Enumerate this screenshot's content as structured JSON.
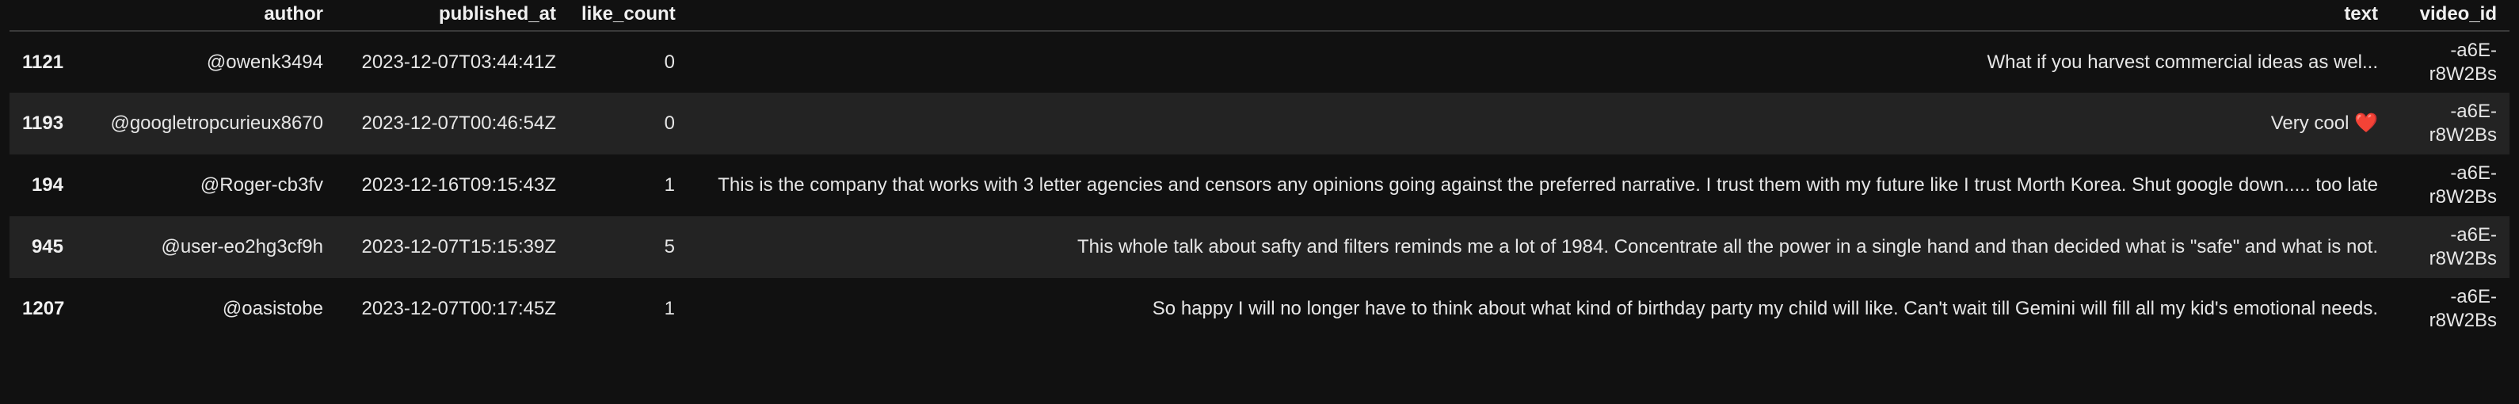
{
  "table": {
    "columns": [
      "",
      "author",
      "published_at",
      "like_count",
      "text",
      "video_id"
    ],
    "rows": [
      {
        "index": "1121",
        "author": "@owenk3494",
        "published_at": "2023-12-07T03:44:41Z",
        "like_count": "0",
        "text": "What if you harvest commercial ideas as wel...",
        "video_id": "-a6E-r8W2Bs"
      },
      {
        "index": "1193",
        "author": "@googletropcurieux8670",
        "published_at": "2023-12-07T00:46:54Z",
        "like_count": "0",
        "text": "Very cool ❤️",
        "video_id": "-a6E-r8W2Bs"
      },
      {
        "index": "194",
        "author": "@Roger-cb3fv",
        "published_at": "2023-12-16T09:15:43Z",
        "like_count": "1",
        "text": "This is the company that works with 3 letter agencies and censors any opinions going against the preferred narrative. I trust them with my future like I trust Morth Korea. Shut google down..... too late",
        "video_id": "-a6E-r8W2Bs"
      },
      {
        "index": "945",
        "author": "@user-eo2hg3cf9h",
        "published_at": "2023-12-07T15:15:39Z",
        "like_count": "5",
        "text": "This whole talk about safty and filters reminds me a lot of 1984. Concentrate all the power in a single hand and than decided what is \"safe\" and what is not.",
        "video_id": "-a6E-r8W2Bs"
      },
      {
        "index": "1207",
        "author": "@oasistobe",
        "published_at": "2023-12-07T00:17:45Z",
        "like_count": "1",
        "text": "So happy I will no longer have to think about what kind of birthday party my child will like. Can't wait till Gemini will fill all my kid's emotional needs.",
        "video_id": "-a6E-r8W2Bs"
      }
    ]
  }
}
